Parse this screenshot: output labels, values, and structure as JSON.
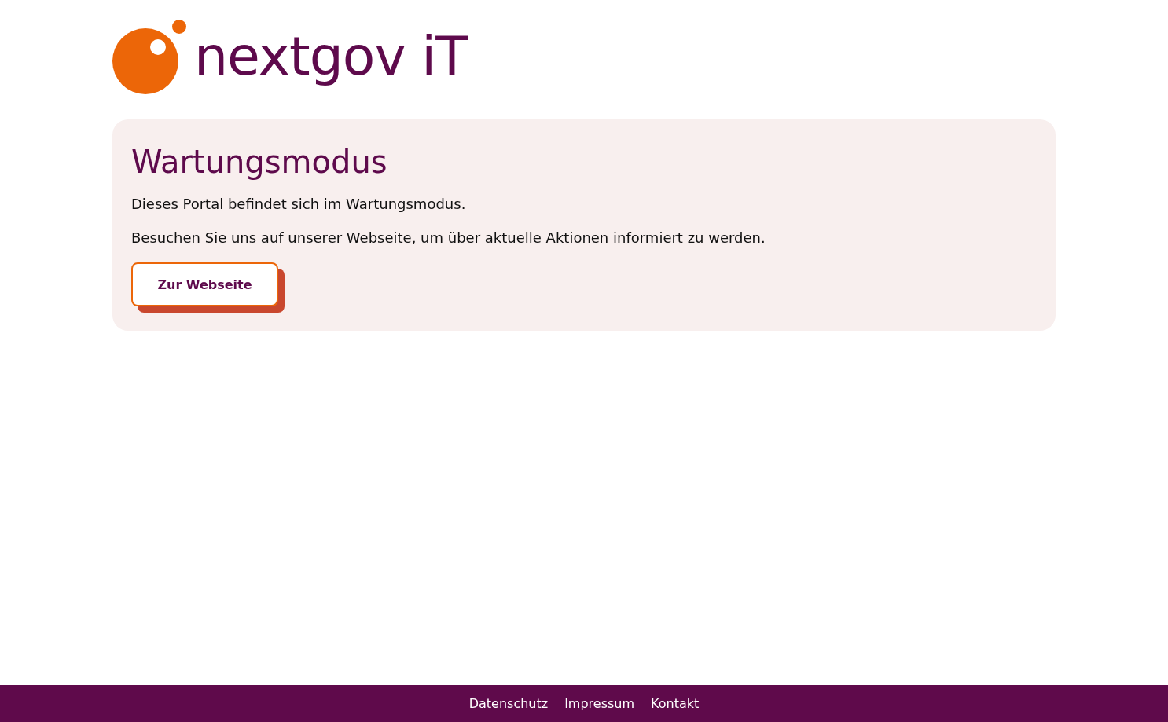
{
  "logo": {
    "text": "nextgov iT"
  },
  "card": {
    "title": "Wartungsmodus",
    "paragraphs": [
      "Dieses Portal befindet sich im Wartungsmodus.",
      "Besuchen Sie uns auf unserer Webseite, um über aktuelle Aktionen informiert zu werden."
    ],
    "button": "Zur Webseite"
  },
  "footer": {
    "links": [
      "Datenschutz",
      "Impressum",
      "Kontakt"
    ]
  }
}
